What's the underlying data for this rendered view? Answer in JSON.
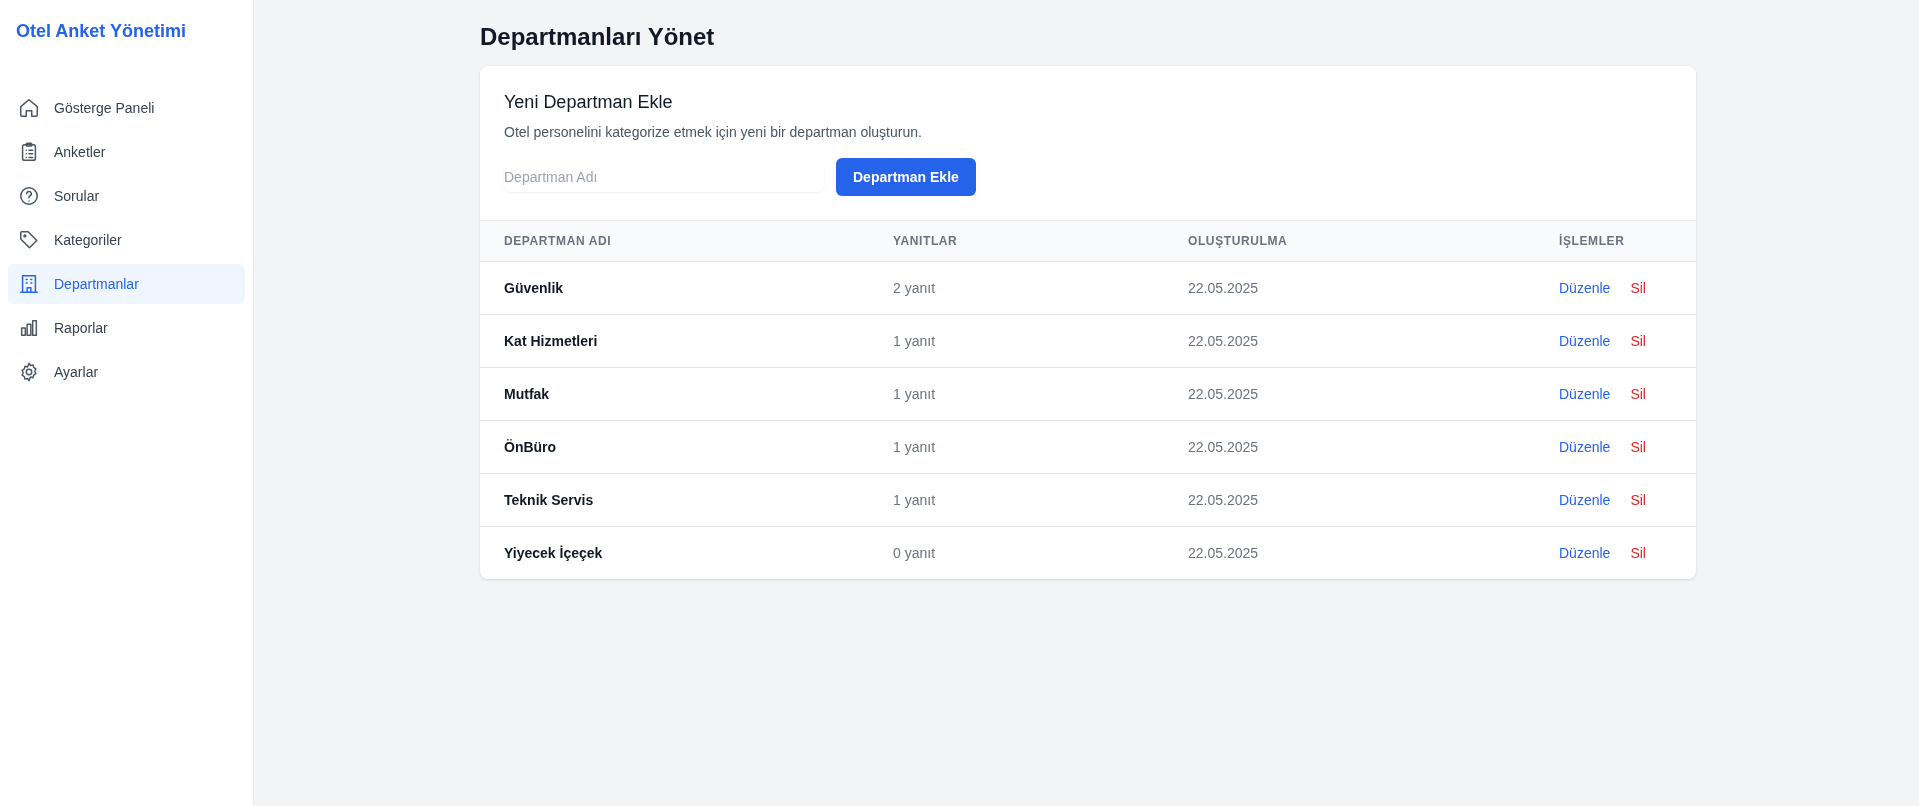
{
  "sidebar": {
    "title": "Otel Anket Yönetimi",
    "items": [
      {
        "label": "Gösterge Paneli",
        "selected": false
      },
      {
        "label": "Anketler",
        "selected": false
      },
      {
        "label": "Sorular",
        "selected": false
      },
      {
        "label": "Kategoriler",
        "selected": false
      },
      {
        "label": "Departmanlar",
        "selected": true
      },
      {
        "label": "Raporlar",
        "selected": false
      },
      {
        "label": "Ayarlar",
        "selected": false
      }
    ]
  },
  "page_title": "Departmanları Yönet",
  "form": {
    "title": "Yeni Departman Ekle",
    "description": "Otel personelini kategorize etmek için yeni bir departman oluşturun.",
    "name_field": {
      "placeholder": "Departman Adı"
    },
    "submit_button": "Departman Ekle"
  },
  "table": {
    "columns": [
      "DEPARTMAN ADI",
      "YANITLAR",
      "OLUŞTURULMA",
      "İŞLEMLER"
    ],
    "rows": [
      {
        "name": "Güvenlik",
        "responses": "2 yanıt",
        "created": "22.05.2025",
        "actions": [
          {
            "label": "Düzenle",
            "kind": "edit"
          },
          {
            "label": "Sil",
            "kind": "delete"
          }
        ]
      },
      {
        "name": "Kat Hizmetleri",
        "responses": "1 yanıt",
        "created": "22.05.2025",
        "actions": [
          {
            "label": "Düzenle",
            "kind": "edit"
          },
          {
            "label": "Sil",
            "kind": "delete"
          }
        ]
      },
      {
        "name": "Mutfak",
        "responses": "1 yanıt",
        "created": "22.05.2025",
        "actions": [
          {
            "label": "Düzenle",
            "kind": "edit"
          },
          {
            "label": "Sil",
            "kind": "delete"
          }
        ]
      },
      {
        "name": "ÖnBüro",
        "responses": "1 yanıt",
        "created": "22.05.2025",
        "actions": [
          {
            "label": "Düzenle",
            "kind": "edit"
          },
          {
            "label": "Sil",
            "kind": "delete"
          }
        ]
      },
      {
        "name": "Teknik Servis",
        "responses": "1 yanıt",
        "created": "22.05.2025",
        "actions": [
          {
            "label": "Düzenle",
            "kind": "edit"
          },
          {
            "label": "Sil",
            "kind": "delete"
          }
        ]
      },
      {
        "name": "Yiyecek İçeçek",
        "responses": "0 yanıt",
        "created": "22.05.2025",
        "actions": [
          {
            "label": "Düzenle",
            "kind": "edit"
          },
          {
            "label": "Sil",
            "kind": "delete"
          }
        ]
      }
    ]
  }
}
